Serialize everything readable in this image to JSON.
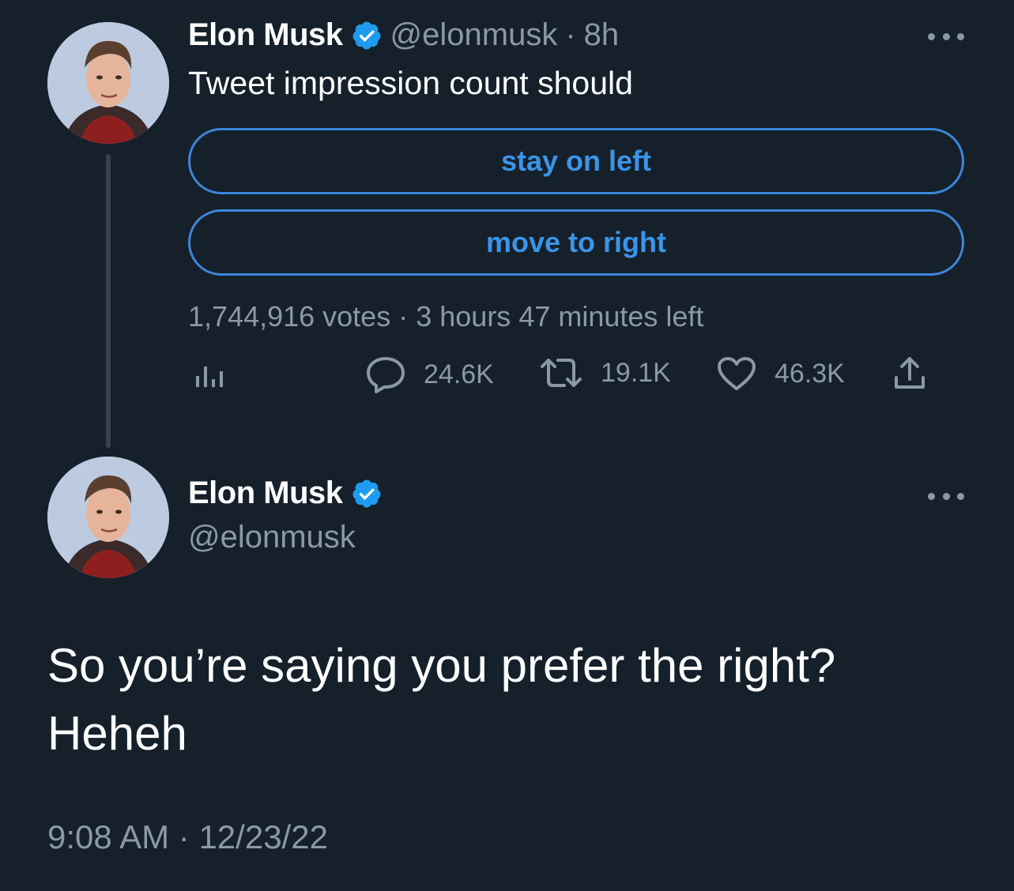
{
  "colors": {
    "background": "#15202b",
    "accent": "#1d9bf0",
    "secondary_text": "#8b98a5",
    "thread_line": "#38444d"
  },
  "tweet1": {
    "author_name": "Elon Musk",
    "verified_icon": "verified-badge-icon",
    "handle": "@elonmusk",
    "separator": "·",
    "time": "8h",
    "more_icon": "more-horizontal-icon",
    "text": "Tweet impression count should",
    "poll": {
      "options": [
        "stay on left",
        "move to right"
      ],
      "votes": "1,744,916 votes",
      "separator": "·",
      "time_left": "3 hours 47 minutes left"
    },
    "actions": {
      "analytics_icon": "analytics-icon",
      "reply_icon": "reply-icon",
      "replies": "24.6K",
      "retweet_icon": "retweet-icon",
      "retweets": "19.1K",
      "like_icon": "heart-icon",
      "likes": "46.3K",
      "share_icon": "share-icon"
    }
  },
  "tweet2": {
    "author_name": "Elon Musk",
    "verified_icon": "verified-badge-icon",
    "handle": "@elonmusk",
    "more_icon": "more-horizontal-icon",
    "text_line1": "So you’re saying you prefer the right?",
    "text_line2": "Heheh",
    "time": "9:08 AM",
    "separator": "·",
    "date": "12/23/22"
  }
}
